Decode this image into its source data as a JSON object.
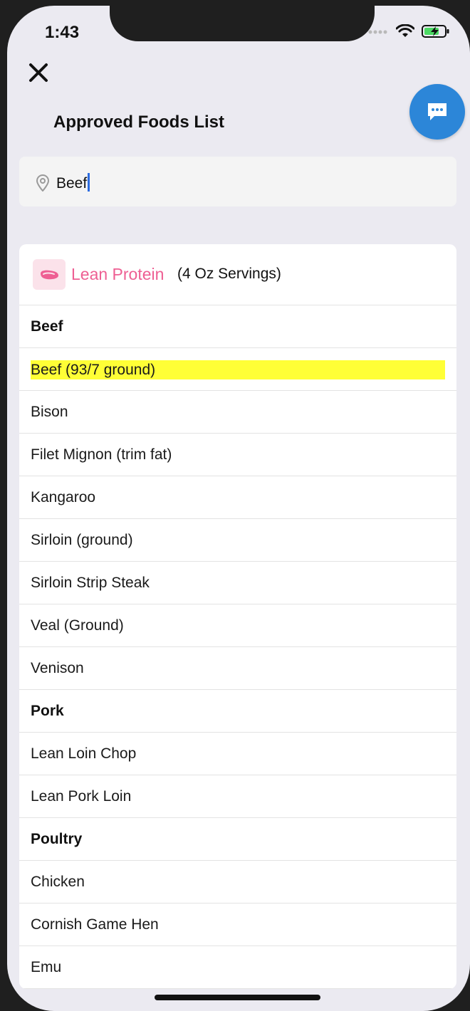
{
  "status_bar": {
    "time": "1:43",
    "icons": [
      "signal-icon",
      "wifi-icon",
      "battery-charging-icon"
    ]
  },
  "header": {
    "title": "Approved Foods List",
    "close_icon": "close-icon",
    "chat_icon": "chat-bubble-icon"
  },
  "search": {
    "value": "Beef",
    "icon": "location-pin-icon"
  },
  "category": {
    "name": "Lean Protein",
    "serving": "(4 Oz Servings)",
    "icon": "steak-icon",
    "accent": "#ee5f93",
    "icon_bg": "#fbe2ea"
  },
  "rows": [
    {
      "label": "Beef",
      "type": "header"
    },
    {
      "label": "Beef (93/7 ground)",
      "type": "item",
      "highlighted": true
    },
    {
      "label": "Bison",
      "type": "item"
    },
    {
      "label": "Filet Mignon (trim fat)",
      "type": "item"
    },
    {
      "label": "Kangaroo",
      "type": "item"
    },
    {
      "label": "Sirloin (ground)",
      "type": "item"
    },
    {
      "label": "Sirloin Strip Steak",
      "type": "item"
    },
    {
      "label": "Veal (Ground)",
      "type": "item"
    },
    {
      "label": "Venison",
      "type": "item"
    },
    {
      "label": "Pork",
      "type": "header"
    },
    {
      "label": "Lean Loin Chop",
      "type": "item"
    },
    {
      "label": "Lean Pork Loin",
      "type": "item"
    },
    {
      "label": "Poultry",
      "type": "header"
    },
    {
      "label": "Chicken",
      "type": "item"
    },
    {
      "label": "Cornish Game Hen",
      "type": "item"
    },
    {
      "label": "Emu",
      "type": "item"
    }
  ],
  "colors": {
    "highlight": "#ffff36",
    "fab": "#2c86d8",
    "background": "#ebeaf1"
  }
}
